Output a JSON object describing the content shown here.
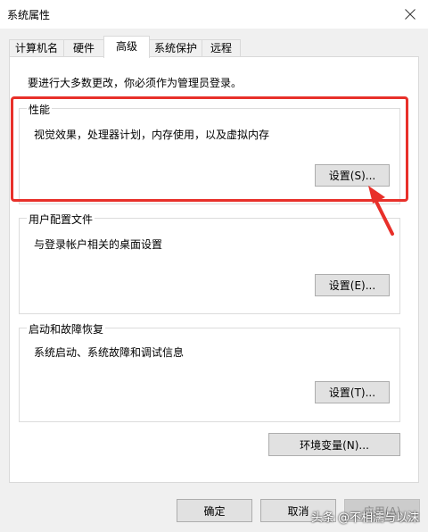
{
  "window": {
    "title": "系统属性"
  },
  "tabs": [
    {
      "label": "计算机名"
    },
    {
      "label": "硬件"
    },
    {
      "label": "高级"
    },
    {
      "label": "系统保护"
    },
    {
      "label": "远程"
    }
  ],
  "active_tab": "高级",
  "panel": {
    "admin_note": "要进行大多数更改，你必须作为管理员登录。",
    "performance": {
      "title": "性能",
      "description": "视觉效果，处理器计划，内存使用，以及虚拟内存",
      "button": "设置(S)..."
    },
    "user_profiles": {
      "title": "用户配置文件",
      "description": "与登录帐户相关的桌面设置",
      "button": "设置(E)..."
    },
    "startup_recovery": {
      "title": "启动和故障恢复",
      "description": "系统启动、系统故障和调试信息",
      "button": "设置(T)..."
    },
    "env_button": "环境变量(N)..."
  },
  "footer": {
    "ok": "确定",
    "cancel": "取消",
    "apply": "应用(A)"
  },
  "watermark": "头条 @不相濡与以沫",
  "colors": {
    "highlight": "#e8302a",
    "button_bg": "#e1e1e1",
    "panel_bg": "#ffffff",
    "window_bg": "#f0f0f0"
  }
}
